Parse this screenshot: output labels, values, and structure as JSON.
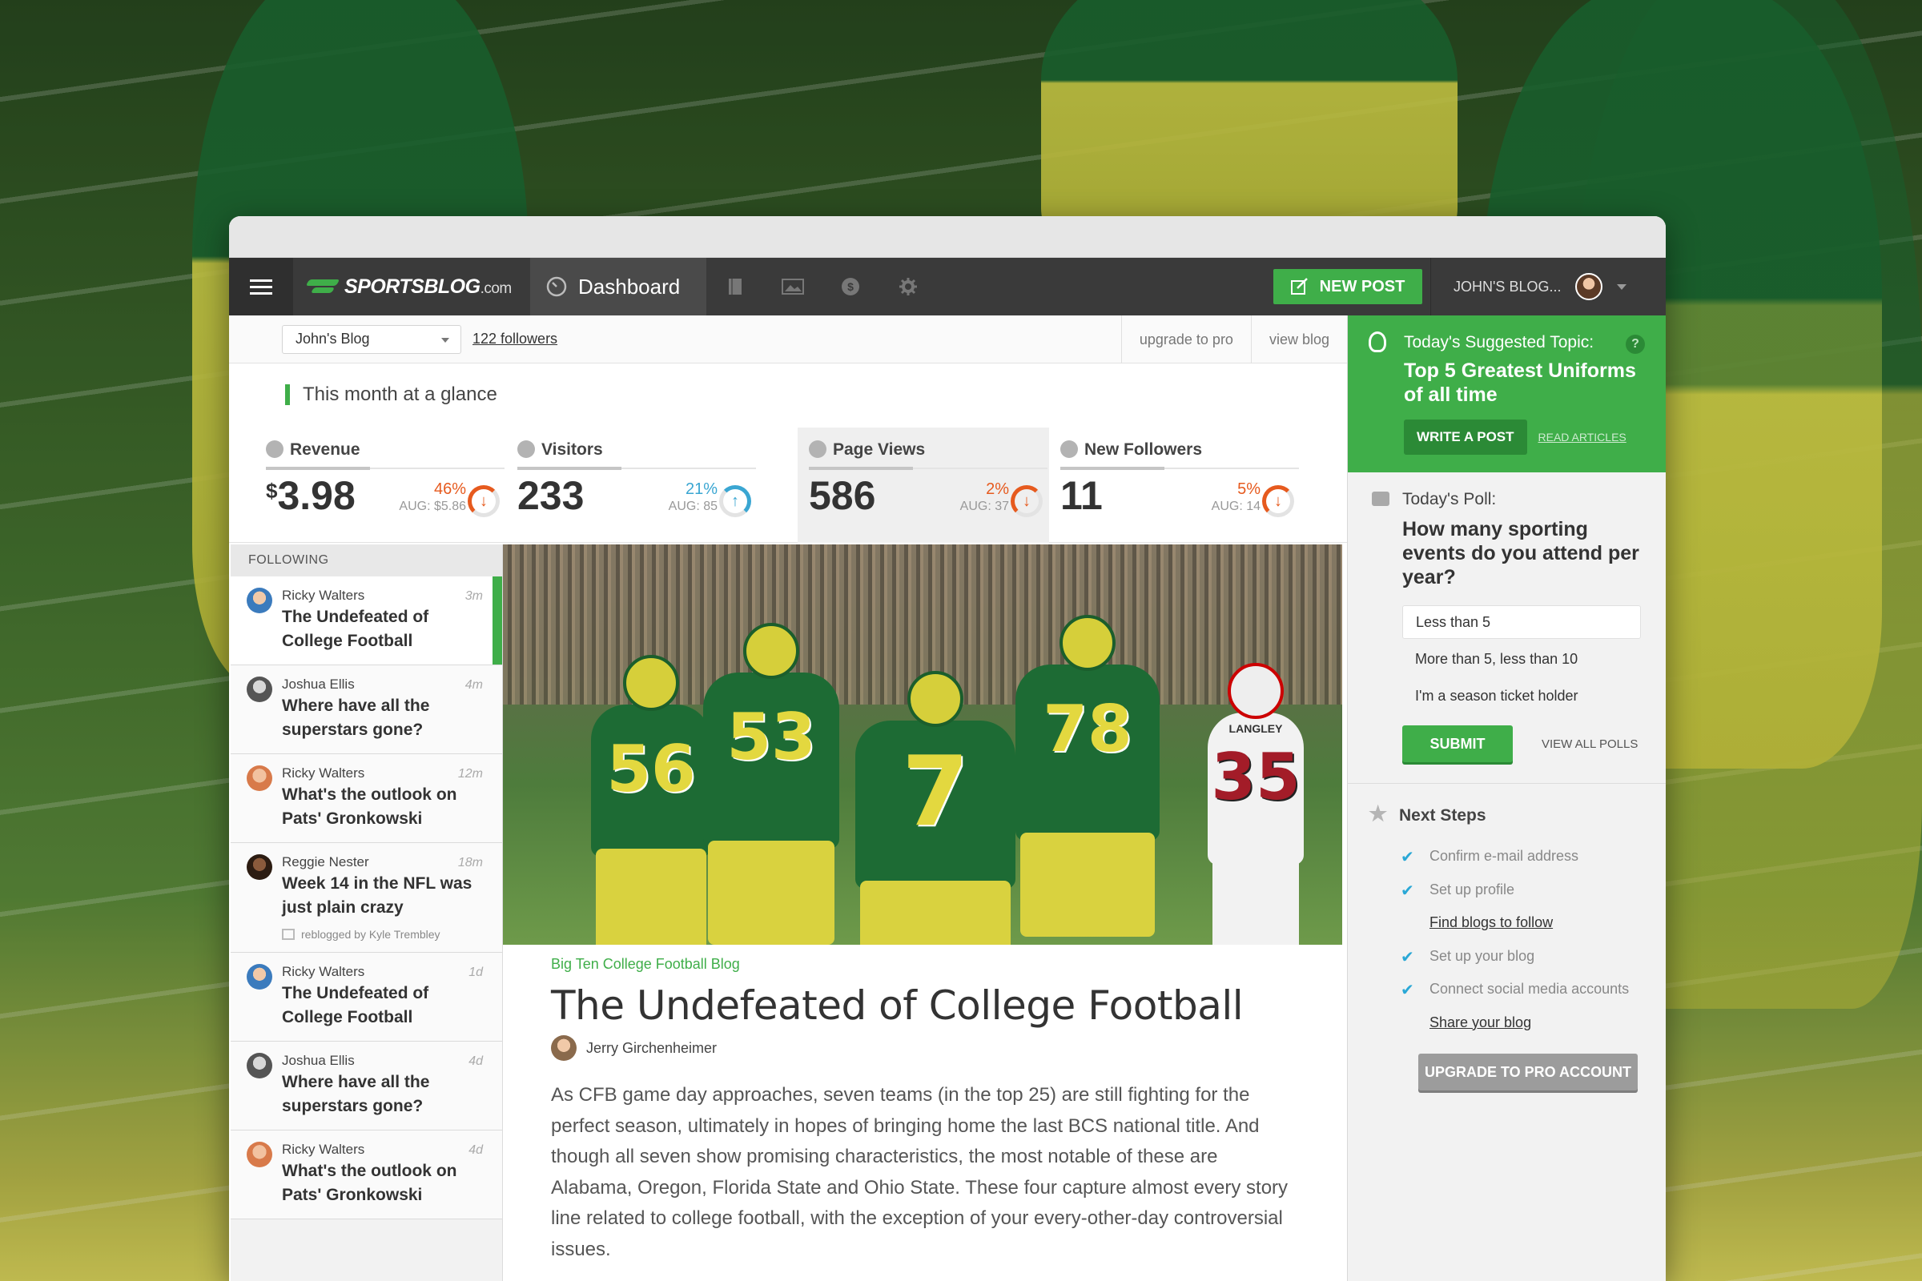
{
  "brand": {
    "name": "SPORTSBLOG",
    "suffix": ".com",
    "accent": "#3fae49"
  },
  "topbar": {
    "dashboard_label": "Dashboard",
    "nav_icons": [
      "book-icon",
      "image-icon",
      "dollar-icon",
      "gear-icon"
    ],
    "new_post_label": "NEW POST",
    "user_blog_label": "JOHN'S BLOG..."
  },
  "subbar": {
    "selected_blog": "John's Blog",
    "followers": "122 followers",
    "upgrade_link": "upgrade to pro",
    "view_blog_link": "view blog"
  },
  "glance": {
    "title": "This month at a glance",
    "stats": [
      {
        "label": "Revenue",
        "currency": "$",
        "value": "3.98",
        "pct": "46%",
        "avg": "AUG: $5.86",
        "trend": "down",
        "color": "#e65a1e"
      },
      {
        "label": "Visitors",
        "currency": "",
        "value": "233",
        "pct": "21%",
        "avg": "AUG: 85",
        "trend": "up",
        "color": "#3aa6d2"
      },
      {
        "label": "Page Views",
        "currency": "",
        "value": "586",
        "pct": "2%",
        "avg": "AUG: 37",
        "trend": "down",
        "color": "#e65a1e"
      },
      {
        "label": "New Followers",
        "currency": "",
        "value": "11",
        "pct": "5%",
        "avg": "AUG: 14",
        "trend": "down",
        "color": "#e65a1e"
      }
    ]
  },
  "following": {
    "heading": "FOLLOWING",
    "posts": [
      {
        "author": "Ricky Walters",
        "time": "3m",
        "title": "The Undefeated of College Football",
        "reblog": ""
      },
      {
        "author": "Joshua Ellis",
        "time": "4m",
        "title": "Where have all the superstars gone?",
        "reblog": ""
      },
      {
        "author": "Ricky Walters",
        "time": "12m",
        "title": "What's the outlook on Pats' Gronkowski",
        "reblog": ""
      },
      {
        "author": "Reggie Nester",
        "time": "18m",
        "title": "Week 14 in the NFL was just plain crazy",
        "reblog": "reblogged by Kyle Trembley"
      },
      {
        "author": "Ricky Walters",
        "time": "1d",
        "title": "The Undefeated of College Football",
        "reblog": ""
      },
      {
        "author": "Joshua Ellis",
        "time": "4d",
        "title": "Where have all the superstars gone?",
        "reblog": ""
      },
      {
        "author": "Ricky Walters",
        "time": "4d",
        "title": "What's the outlook on Pats' Gronkowski",
        "reblog": ""
      }
    ]
  },
  "hero": {
    "players": [
      "56",
      "53",
      "7",
      "78",
      "35"
    ],
    "name_bar": "LANGLEY"
  },
  "article": {
    "category": "Big Ten College Football Blog",
    "title": "The Undefeated of College Football",
    "author": "Jerry Girchenheimer",
    "body": "As CFB game day approaches, seven teams (in the top 25) are still fighting for the perfect season, ultimately in hopes of bringing home the last BCS national title. And though all seven show promising characteristics, the most notable of these are Alabama, Oregon, Florida State and Ohio State. These four capture almost every story line related to college football, with the exception of your every-other-day controversial issues."
  },
  "suggested": {
    "label": "Today's Suggested Topic:",
    "topic": "Top 5 Greatest Uniforms of all time",
    "write_button": "WRITE A POST",
    "read_link": "READ ARTICLES",
    "help": "?"
  },
  "poll": {
    "label": "Today's Poll:",
    "question": "How many sporting events do you attend per year?",
    "options": [
      "Less than 5",
      "More than 5, less than 10",
      "I'm a season ticket holder"
    ],
    "selected": "Less than 5",
    "submit": "SUBMIT",
    "view_all": "VIEW ALL POLLS"
  },
  "next_steps": {
    "title": "Next Steps",
    "items": [
      {
        "label": "Confirm e-mail address",
        "done": true
      },
      {
        "label": "Set up profile",
        "done": true
      },
      {
        "label": "Find blogs to follow",
        "done": false
      },
      {
        "label": "Set up your blog",
        "done": true
      },
      {
        "label": "Connect social media accounts",
        "done": true
      },
      {
        "label": "Share your blog",
        "done": false
      }
    ],
    "upgrade_button": "UPGRADE TO PRO ACCOUNT"
  }
}
